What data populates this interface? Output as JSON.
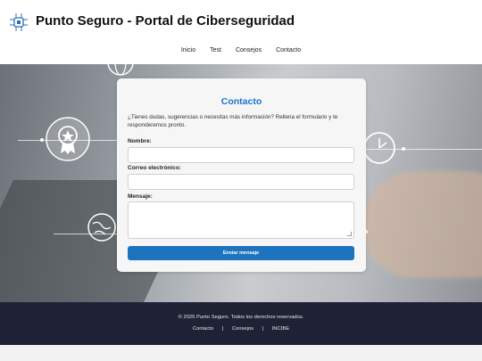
{
  "header": {
    "title": "Punto Seguro - Portal de Ciberseguridad",
    "logo_icon": "circuit-chip-icon"
  },
  "nav": {
    "items": [
      {
        "label": "Inicio"
      },
      {
        "label": "Test"
      },
      {
        "label": "Consejos"
      },
      {
        "label": "Contacto"
      }
    ]
  },
  "form": {
    "title": "Contacto",
    "intro": "¿Tienes dudas, sugerencias o necesitas más información? Rellena el formulario y te responderemos pronto.",
    "name_label": "Nombre:",
    "name_value": "",
    "email_label": "Correo electrónico:",
    "email_value": "",
    "message_label": "Mensaje:",
    "message_value": "",
    "submit_label": "Enviar mensaje",
    "accent_color": "#1e73be"
  },
  "footer": {
    "copyright": "© 2025 Punto Seguro. Todos los derechos reservados.",
    "links": [
      {
        "label": "Contacto"
      },
      {
        "label": "Consejos"
      },
      {
        "label": "INCIBE"
      }
    ],
    "separator": "|",
    "background_color": "#1f2235"
  },
  "hero": {
    "icons": [
      "globe-icon",
      "award-badge-icon",
      "clock-icon",
      "globe-icon"
    ]
  }
}
